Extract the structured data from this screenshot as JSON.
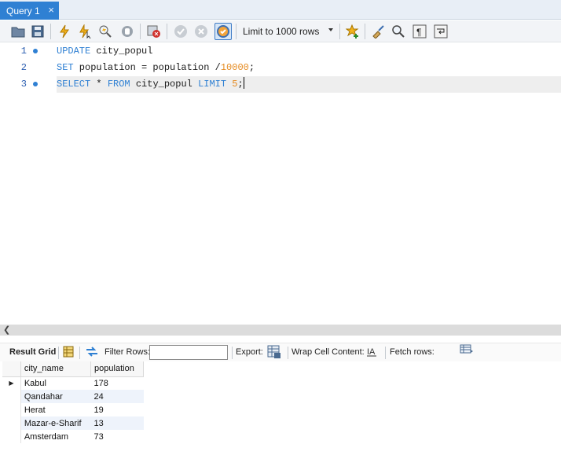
{
  "tabs": [
    {
      "label": "Query 1",
      "close": "×"
    }
  ],
  "toolbar": {
    "limit_value": "Limit to 1000 rows"
  },
  "editor": {
    "line_numbers": [
      "1",
      "2",
      "3"
    ],
    "line1": {
      "kw1": "UPDATE",
      "t1": " city_popul"
    },
    "line2": {
      "kw1": "SET",
      "t1": " population = population /",
      "num": "10000",
      "t2": ";"
    },
    "line3": {
      "kw1": "SELECT",
      "t1": " * ",
      "kw2": "FROM",
      "t2": " city_popul ",
      "kw3": "LIMIT",
      "t3": " ",
      "num": "5",
      "t4": ";"
    }
  },
  "results_toolbar": {
    "result_grid": "Result Grid",
    "filter_rows": "Filter Rows:",
    "filter_value": "",
    "export": "Export:",
    "wrap": "Wrap Cell Content:",
    "fetch": "Fetch rows:"
  },
  "results": {
    "columns": [
      "city_name",
      "population"
    ],
    "rows": [
      [
        "Kabul",
        "178"
      ],
      [
        "Qandahar",
        "24"
      ],
      [
        "Herat",
        "19"
      ],
      [
        "Mazar-e-Sharif",
        "13"
      ],
      [
        "Amsterdam",
        "73"
      ]
    ]
  },
  "colors": {
    "tab_active": "#2f80d3",
    "keyword": "#2f80d3",
    "number": "#e58a1f",
    "row_alt": "#eef3fb"
  }
}
